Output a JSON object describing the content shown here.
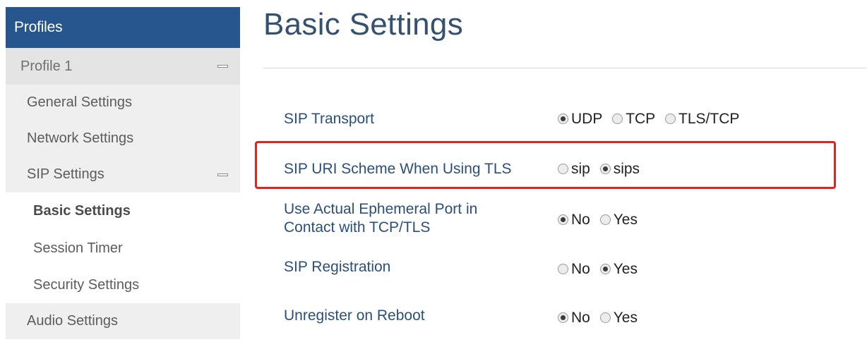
{
  "sidebar": {
    "header": "Profiles",
    "profile": "Profile 1",
    "items": [
      {
        "label": "General Settings"
      },
      {
        "label": "Network Settings"
      },
      {
        "label": "SIP Settings"
      }
    ],
    "sip_subitems": [
      {
        "label": "Basic Settings",
        "active": true
      },
      {
        "label": "Session Timer"
      },
      {
        "label": "Security Settings"
      }
    ],
    "audio": "Audio Settings"
  },
  "main": {
    "title": "Basic Settings",
    "settings": [
      {
        "label": "SIP Transport",
        "options": [
          "UDP",
          "TCP",
          "TLS/TCP"
        ],
        "selected": "UDP"
      },
      {
        "label": "SIP URI Scheme When Using TLS",
        "options": [
          "sip",
          "sips"
        ],
        "selected": "sips"
      },
      {
        "label_line1": "Use Actual Ephemeral Port in",
        "label_line2": "Contact with TCP/TLS",
        "options": [
          "No",
          "Yes"
        ],
        "selected": "No"
      },
      {
        "label": "SIP Registration",
        "options": [
          "No",
          "Yes"
        ],
        "selected": "Yes"
      },
      {
        "label": "Unregister on Reboot",
        "options": [
          "No",
          "Yes"
        ],
        "selected": "No"
      }
    ]
  },
  "colors": {
    "header_bg": "#27558e",
    "title": "#34516f",
    "label": "#2a4f78",
    "highlight": "#e8221b"
  }
}
